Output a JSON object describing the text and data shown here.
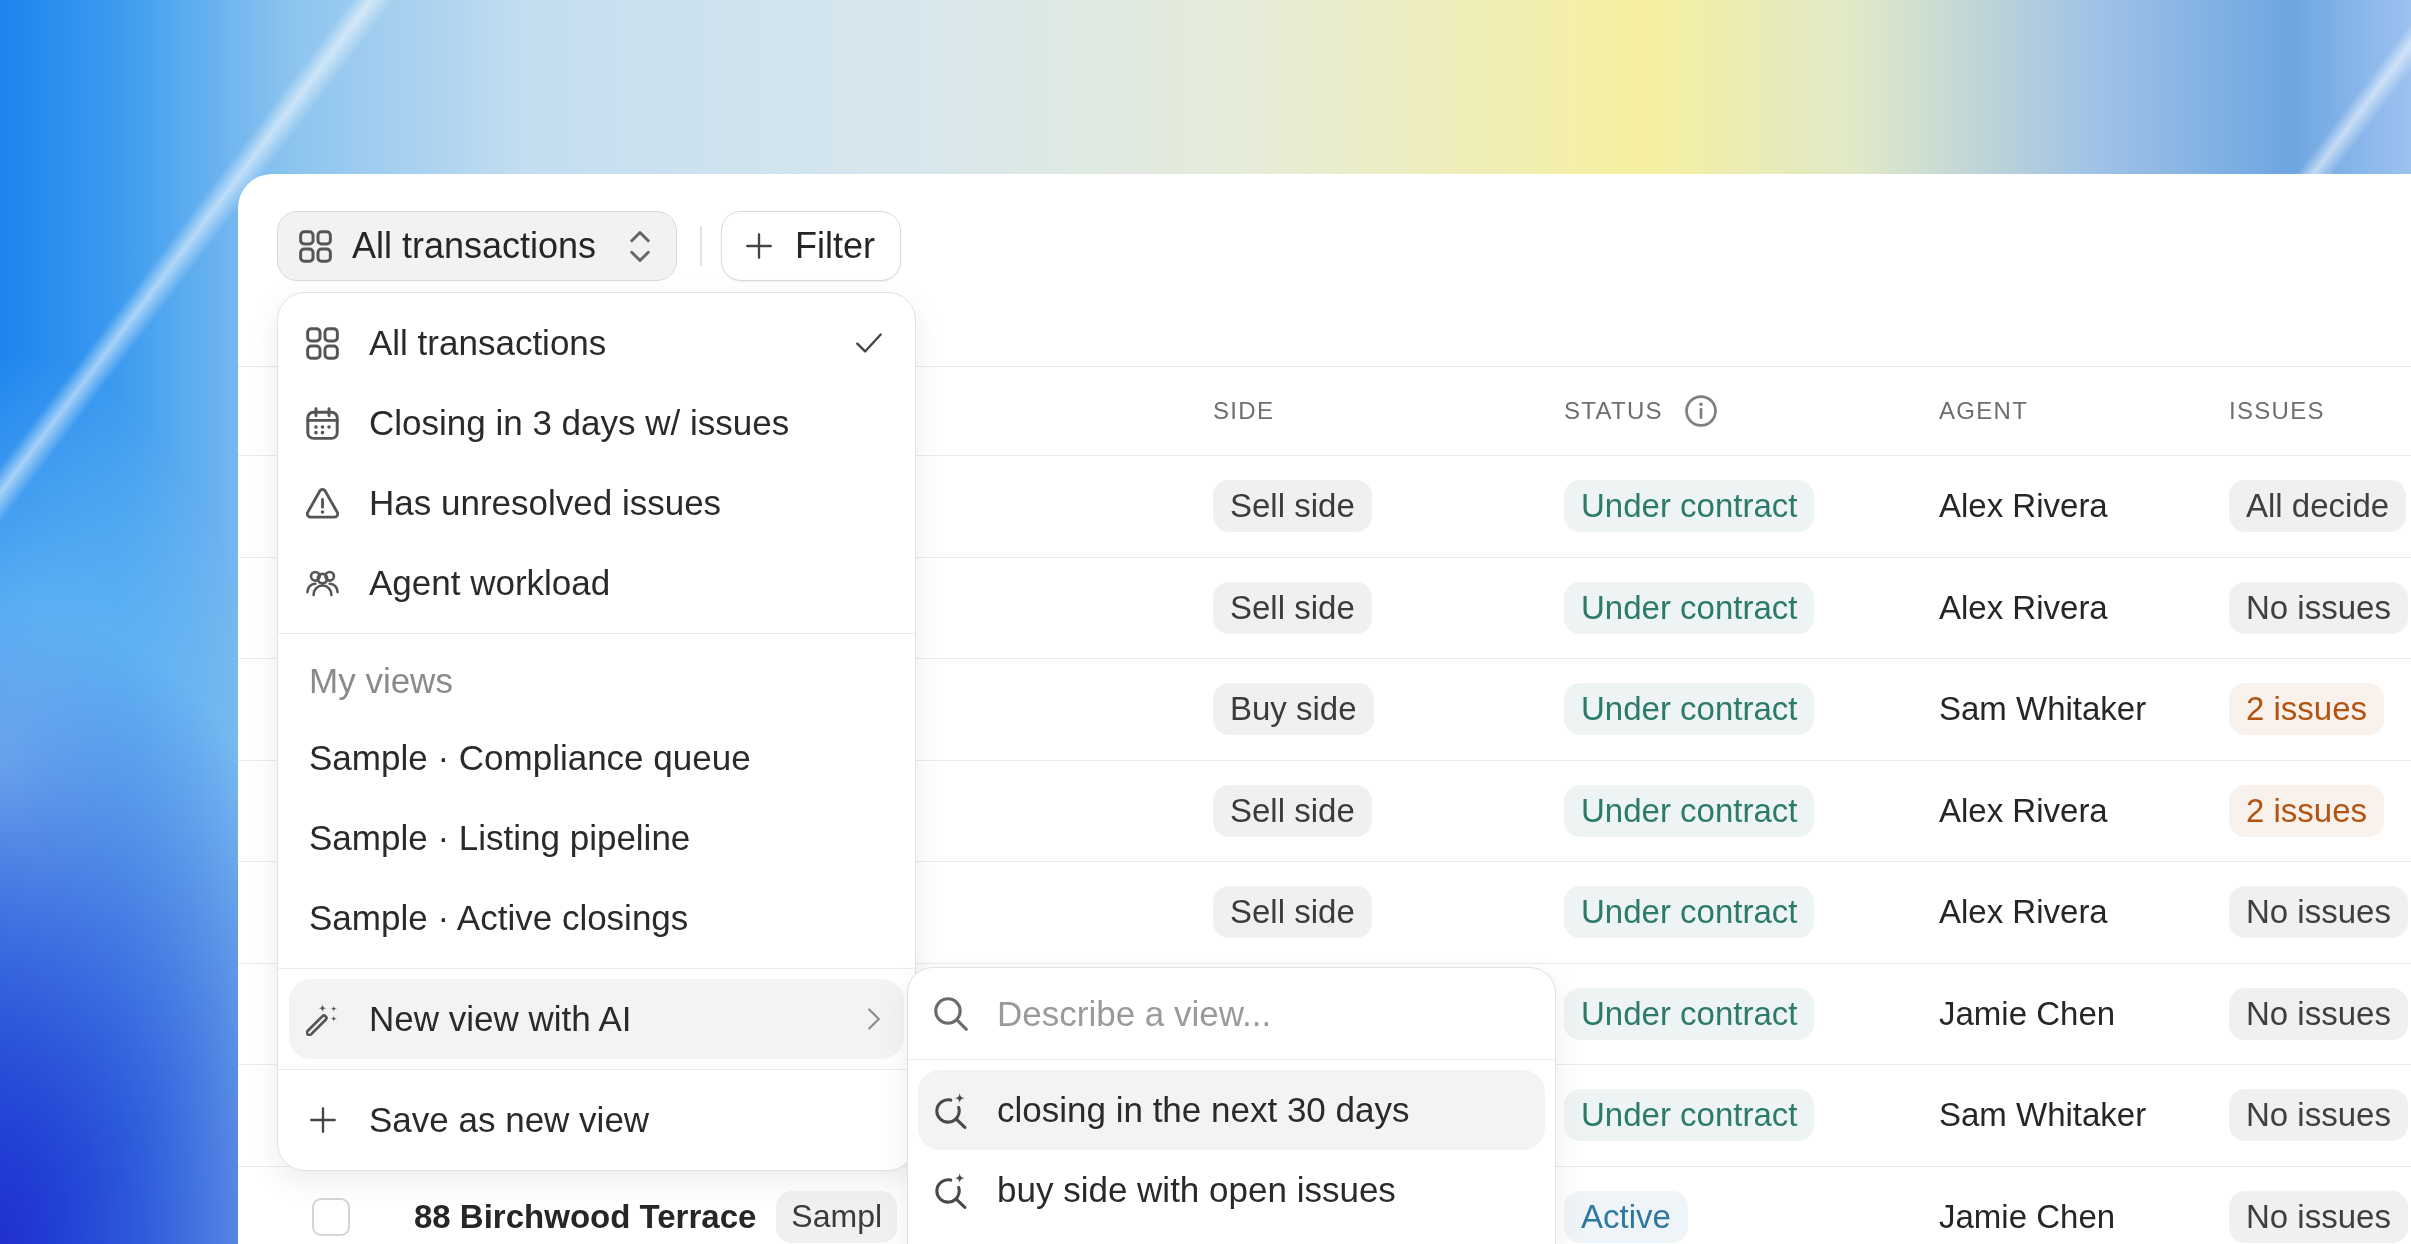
{
  "toolbar": {
    "view_button": {
      "label": "All transactions"
    },
    "filter_button": {
      "label": "Filter"
    }
  },
  "table": {
    "columns": [
      {
        "label": "SIDE",
        "info": false
      },
      {
        "label": "STATUS",
        "info": true
      },
      {
        "label": "AGENT",
        "info": false
      },
      {
        "label": "ISSUES",
        "info": false
      }
    ],
    "rows": [
      {
        "side": "Sell side",
        "status": {
          "label": "Under contract",
          "color": "#2b7a6b"
        },
        "agent": "Alex Rivera",
        "issues": {
          "label": "All decide",
          "color": "#3f3f3f"
        }
      },
      {
        "side": "Sell side",
        "status": {
          "label": "Under contract",
          "color": "#2b7a6b"
        },
        "agent": "Alex Rivera",
        "issues": {
          "label": "No issues",
          "color": "#3f3f3f"
        }
      },
      {
        "side": "Buy side",
        "status": {
          "label": "Under contract",
          "color": "#2b7a6b"
        },
        "agent": "Sam Whitaker",
        "issues": {
          "label": "2 issues",
          "color": "#b4530f"
        }
      },
      {
        "side": "Sell side",
        "status": {
          "label": "Under contract",
          "color": "#2b7a6b"
        },
        "agent": "Alex Rivera",
        "issues": {
          "label": "2 issues",
          "color": "#b4530f"
        }
      },
      {
        "side": "Sell side",
        "status": {
          "label": "Under contract",
          "color": "#2b7a6b"
        },
        "agent": "Alex Rivera",
        "issues": {
          "label": "No issues",
          "color": "#3f3f3f"
        }
      },
      {
        "status": {
          "label": "Under contract",
          "color": "#2b7a6b"
        },
        "agent": "Jamie Chen",
        "issues": {
          "label": "No issues",
          "color": "#3f3f3f"
        }
      },
      {
        "status": {
          "label": "Under contract",
          "color": "#2b7a6b"
        },
        "agent": "Sam Whitaker",
        "issues": {
          "label": "No issues",
          "color": "#3f3f3f"
        }
      },
      {
        "checked": false,
        "address": "88 Birchwood Terrace",
        "tag": "Sampl",
        "status": {
          "label": "Active",
          "color": "#2e78a0"
        },
        "agent": "Jamie Chen",
        "issues": {
          "label": "No issues",
          "color": "#3f3f3f"
        }
      }
    ]
  },
  "view_menu": {
    "presets": [
      {
        "label": "All transactions",
        "selected": true
      },
      {
        "label": "Closing in 3 days w/ issues",
        "selected": false
      },
      {
        "label": "Has unresolved issues",
        "selected": false
      },
      {
        "label": "Agent workload",
        "selected": false
      }
    ],
    "my_views": {
      "heading": "My views",
      "items": [
        {
          "label": "Sample · Compliance queue",
          "selected": false
        },
        {
          "label": "Sample · Listing pipeline",
          "selected": false
        },
        {
          "label": "Sample · Active closings",
          "selected": false
        }
      ]
    },
    "actions": [
      {
        "kind": "submenu",
        "label": "New view with AI",
        "highlighted": true
      },
      {
        "kind": "command",
        "label": "Save as new view",
        "highlighted": false
      }
    ]
  },
  "ai_submenu": {
    "search": {
      "placeholder": "Describe a view..."
    },
    "suggestions": [
      {
        "label": "closing in the next 30 days",
        "highlighted": true
      },
      {
        "label": "buy side with open issues",
        "highlighted": false
      }
    ]
  }
}
